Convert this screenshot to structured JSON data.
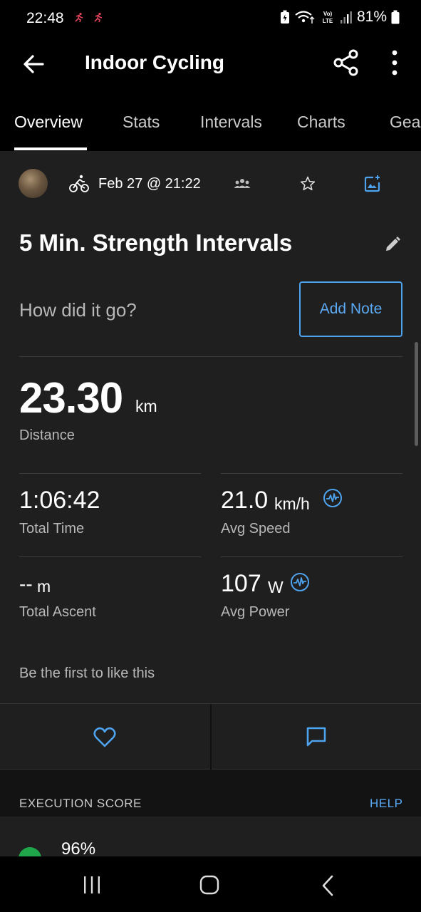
{
  "status_bar": {
    "time": "22:48",
    "battery": "81%",
    "icons": [
      "runner-notification-icon",
      "runner-notification-icon",
      "battery-saver-icon",
      "wifi-icon",
      "volte-icon",
      "signal-icon",
      "battery-icon"
    ]
  },
  "app_bar": {
    "title": "Indoor Cycling"
  },
  "tabs": [
    {
      "label": "Overview",
      "active": true
    },
    {
      "label": "Stats",
      "active": false
    },
    {
      "label": "Intervals",
      "active": false
    },
    {
      "label": "Charts",
      "active": false
    },
    {
      "label": "Gea",
      "active": false
    }
  ],
  "activity": {
    "date": "Feb 27 @ 21:22",
    "name": "5 Min. Strength Intervals",
    "prompt": "How did it go?",
    "add_note_label": "Add Note"
  },
  "distance": {
    "value": "23.30",
    "unit": "km",
    "label": "Distance"
  },
  "stats": {
    "total_time": {
      "value": "1:06:42",
      "label": "Total Time"
    },
    "avg_speed": {
      "value": "21.0",
      "unit": "km/h",
      "label": "Avg Speed"
    },
    "total_ascent": {
      "value": "--",
      "unit": "m",
      "label": "Total Ascent"
    },
    "avg_power": {
      "value": "107",
      "unit": "W",
      "label": "Avg Power"
    }
  },
  "social": {
    "likes_text": "Be the first to like this"
  },
  "execution": {
    "title": "EXECUTION SCORE",
    "help_label": "HELP",
    "score": "96%"
  },
  "colors": {
    "accent": "#4ea3ef",
    "background": "#1f1f1f",
    "score_green": "#1fa64a"
  }
}
